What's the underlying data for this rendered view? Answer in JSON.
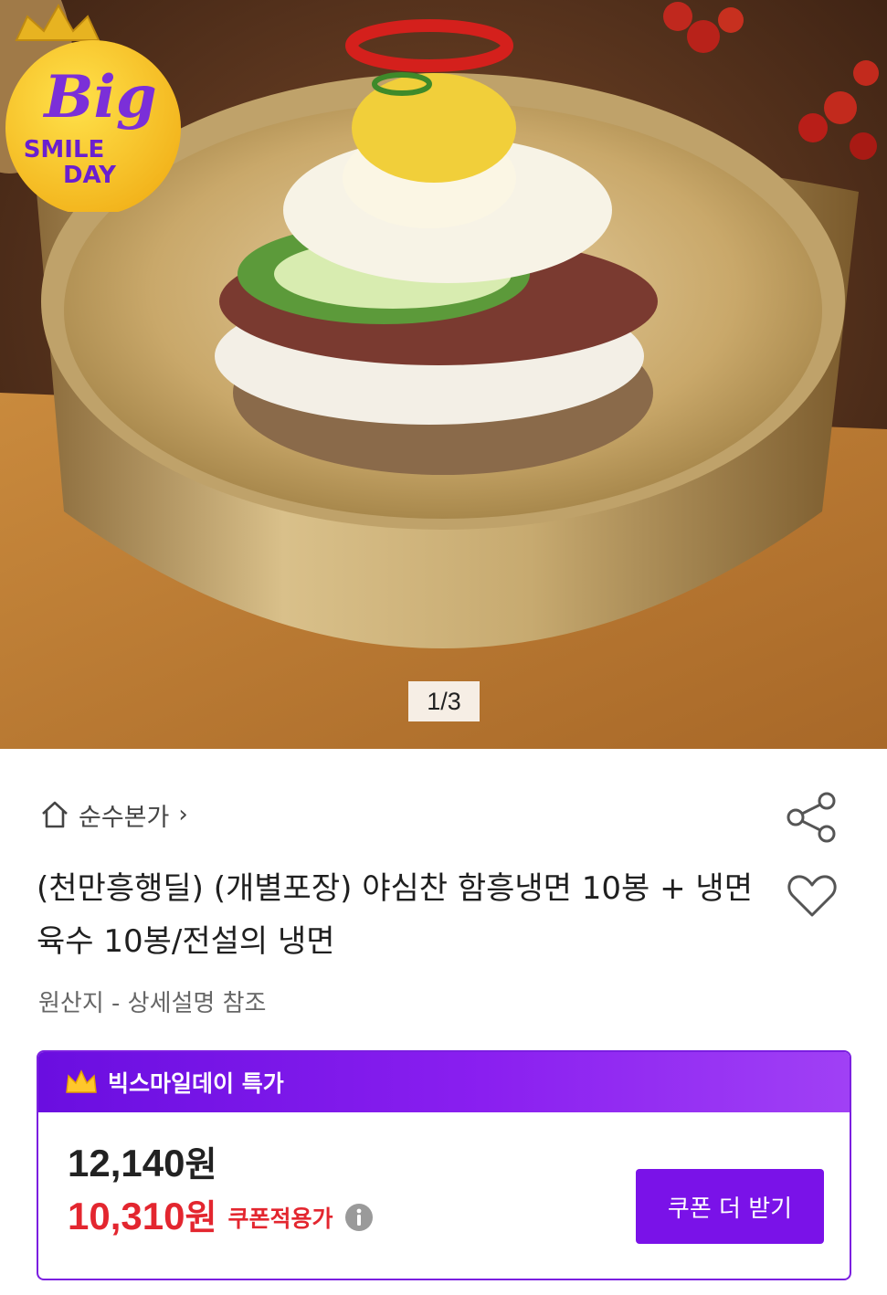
{
  "hero": {
    "page_indicator": "1/3",
    "badge": {
      "line1": "Big",
      "line2": "SMILE",
      "line3": "DAY"
    }
  },
  "store": {
    "name": "순수본가",
    "chevron": "›",
    "icon": "home-icon"
  },
  "product": {
    "title": "(천만흥행딜) (개별포장) 야심찬 함흥냉면 10봉 + 냉면육수 10봉/전설의 냉면",
    "origin": "원산지 - 상세설명 참조"
  },
  "actions": {
    "share_icon": "share-icon",
    "wishlist_icon": "heart-icon"
  },
  "deal": {
    "label": "빅스마일데이 특가",
    "original_price": "12,140",
    "coupon_price": "10,310",
    "currency": "원",
    "coupon_label": "쿠폰적용가",
    "coupon_button": "쿠폰 더 받기"
  },
  "colors": {
    "accent": "#7a12e8",
    "price_red": "#e3262f",
    "badge_yellow": "#f7c51e"
  }
}
